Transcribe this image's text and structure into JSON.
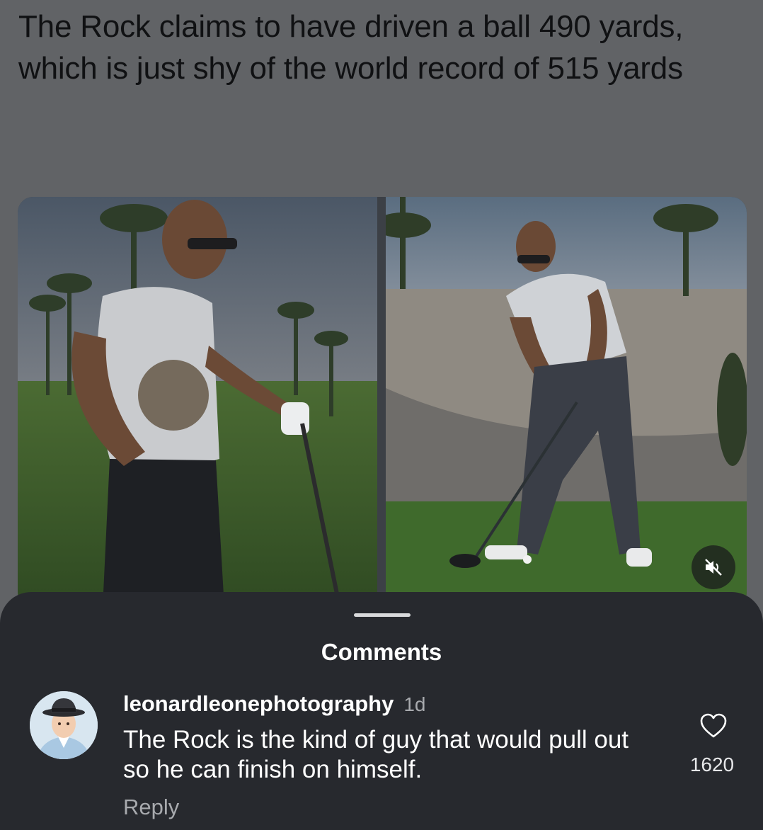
{
  "post": {
    "caption": "The Rock claims to have driven a ball 490 yards, which is just shy of the world record of 515 yards",
    "media": {
      "left_photo": "man-with-golf-club-on-course",
      "right_photo": "man-swinging-golf-driver",
      "mute_icon": "speaker-muted-icon"
    }
  },
  "comments_sheet": {
    "title": "Comments",
    "comments": [
      {
        "username": "leonardleonephotography",
        "time": "1d",
        "text": "The Rock is the kind of guy that would pull out so he can finish on himself.",
        "reply_label": "Reply",
        "likes": "1620",
        "like_icon": "heart-outline-icon"
      }
    ]
  },
  "colors": {
    "sheet_background": "#27292e",
    "dim_overlay": "#616366",
    "primary_text": "#ffffff",
    "secondary_text": "#a8aaae"
  }
}
